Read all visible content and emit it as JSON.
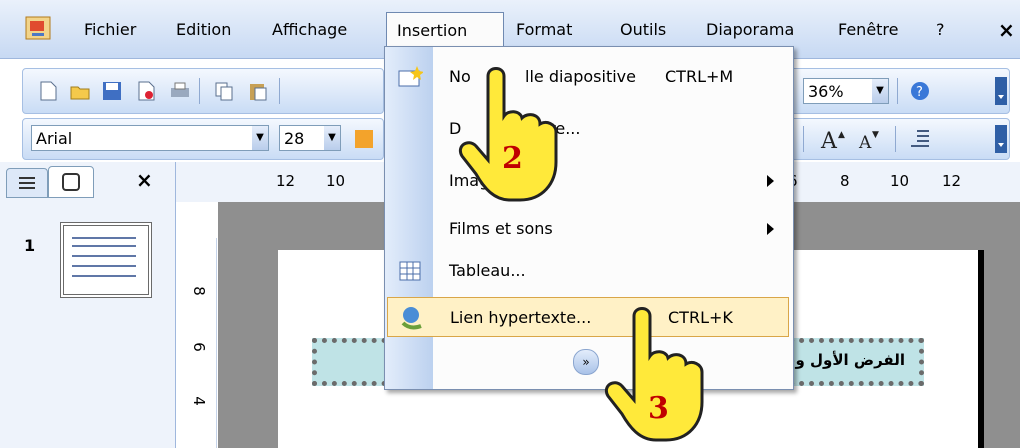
{
  "menubar": {
    "items": [
      "Fichier",
      "Edition",
      "Affichage",
      "Insertion",
      "Format",
      "Outils",
      "Diaporama",
      "Fenêtre",
      "?"
    ],
    "close": "×"
  },
  "formatting": {
    "font": "Arial",
    "size": "28"
  },
  "standard": {
    "zoom": "36%"
  },
  "panel": {
    "close": "×",
    "slide_number": "1"
  },
  "ruler": {
    "top_ticks": [
      "12",
      "10",
      "6",
      "8",
      "10",
      "12"
    ],
    "left_ticks": [
      "8",
      "6",
      "4"
    ]
  },
  "dropdown": {
    "items": [
      {
        "label": "Nouvelle diapositive",
        "shortcut": "CTRL+M"
      },
      {
        "label": "Duplicata de la diapositive...",
        "shortcut": ""
      },
      {
        "label": "Image",
        "shortcut": ""
      },
      {
        "label": "Films et sons",
        "shortcut": ""
      },
      {
        "label": "Tableau...",
        "shortcut": ""
      },
      {
        "label": "Lien hypertexte...",
        "shortcut": "CTRL+K"
      }
    ],
    "visible_labels": [
      "No",
      "lle diapositive",
      "D",
      "ure...",
      "Image",
      "Films et sons",
      "Tableau...",
      "Lien hypertexte..."
    ]
  },
  "slide": {
    "arabic_text": "الفرض الأول      وجيا"
  },
  "annotations": {
    "step2": "2",
    "step3": "3"
  }
}
